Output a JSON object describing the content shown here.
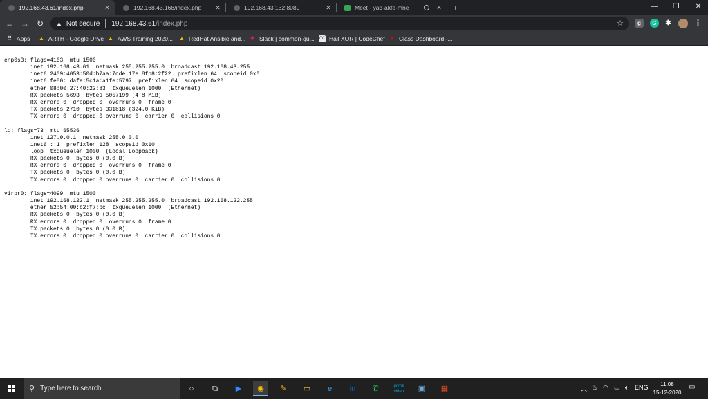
{
  "browser": {
    "tabs": [
      {
        "label": "192.168.43.61/index.php",
        "active": true,
        "icon": "globe-icon"
      },
      {
        "label": "192.168.43.168/index.php",
        "active": false,
        "icon": "globe-icon"
      },
      {
        "label": "192.168.43.132:8080",
        "active": false,
        "icon": "globe-icon"
      },
      {
        "label": "Meet - yab-akfe-mne",
        "active": false,
        "icon": "meet-icon"
      }
    ],
    "new_tab_symbol": "+",
    "window_controls": {
      "minimize": "—",
      "restore": "❐",
      "close": "✕"
    }
  },
  "toolbar": {
    "back": "←",
    "forward": "→",
    "reload": "↻",
    "security_label": "Not secure",
    "url_host": "192.168.43.61",
    "url_path": "/index.php"
  },
  "bookmarks": [
    {
      "label": "Apps",
      "icon": "apps-grid-icon"
    },
    {
      "label": "ARTH - Google Drive",
      "icon": "google-drive-icon"
    },
    {
      "label": "AWS Training 2020...",
      "icon": "google-drive-icon"
    },
    {
      "label": "RedHat Ansible and...",
      "icon": "google-drive-icon"
    },
    {
      "label": "Slack | common-qu...",
      "icon": "slack-icon"
    },
    {
      "label": "Hail XOR | CodeChef",
      "icon": "codechef-icon"
    },
    {
      "label": "Class Dashboard -...",
      "icon": "redhat-icon"
    }
  ],
  "extensions": [
    {
      "letter": "g",
      "color": "#5f6368"
    },
    {
      "letter": "G",
      "color": "#15c39a"
    },
    {
      "letter": "✱",
      "color": "#35363a"
    }
  ],
  "terminal": {
    "blocks": [
      [
        "enp0s3: flags=4163  mtu 1500",
        "        inet 192.168.43.61  netmask 255.255.255.0  broadcast 192.168.43.255",
        "        inet6 2409:4053:50d:b7aa:7dde:17e:8fb8:2f22  prefixlen 64  scopeid 0x0",
        "        inet6 fe80::dafe:5c1a:a1fe:5797  prefixlen 64  scopeid 0x20",
        "        ether 08:00:27:40:23:83  txqueuelen 1000  (Ethernet)",
        "        RX packets 5693  bytes 5057199 (4.8 MiB)",
        "        RX errors 0  dropped 0  overruns 0  frame 0",
        "        TX packets 2710  bytes 331818 (324.0 KiB)",
        "        TX errors 0  dropped 0 overruns 0  carrier 0  collisions 0"
      ],
      [
        "lo: flags=73  mtu 65536",
        "        inet 127.0.0.1  netmask 255.0.0.0",
        "        inet6 ::1  prefixlen 128  scopeid 0x10",
        "        loop  txqueuelen 1000  (Local Loopback)",
        "        RX packets 0  bytes 0 (0.0 B)",
        "        RX errors 0  dropped 0  overruns 0  frame 0",
        "        TX packets 0  bytes 0 (0.0 B)",
        "        TX errors 0  dropped 0 overruns 0  carrier 0  collisions 0"
      ],
      [
        "virbr0: flags=4099  mtu 1500",
        "        inet 192.168.122.1  netmask 255.255.255.0  broadcast 192.168.122.255",
        "        ether 52:54:00:b2:f7:bc  txqueuelen 1000  (Ethernet)",
        "        RX packets 0  bytes 0 (0.0 B)",
        "        RX errors 0  dropped 0  overruns 0  frame 0",
        "        TX packets 0  bytes 0 (0.0 B)",
        "        TX errors 0  dropped 0 overruns 0  carrier 0  collisions 0"
      ]
    ]
  },
  "taskbar": {
    "search_placeholder": "Type here to search",
    "apps": [
      {
        "name": "cortana-icon",
        "glyph": "○"
      },
      {
        "name": "task-view-icon",
        "glyph": "⧉"
      },
      {
        "name": "zoom-icon",
        "glyph": "▶"
      },
      {
        "name": "chrome-icon",
        "glyph": "◉",
        "active": true
      },
      {
        "name": "paint-icon",
        "glyph": "✎"
      },
      {
        "name": "file-explorer-icon",
        "glyph": "▭"
      },
      {
        "name": "edge-icon",
        "glyph": "e"
      },
      {
        "name": "linkedin-icon",
        "glyph": "in"
      },
      {
        "name": "whatsapp-icon",
        "glyph": "✆"
      },
      {
        "name": "prime-video-icon",
        "glyph": "prime video"
      },
      {
        "name": "virtualbox-icon",
        "glyph": "▣"
      },
      {
        "name": "media-app-icon",
        "glyph": "▦"
      }
    ],
    "language": "ENG",
    "time": "11:08",
    "date": "15-12-2020"
  },
  "colors": {
    "tabstrip_bg": "#202124",
    "toolbar_bg": "#35363a",
    "taskbar_bg": "#202020"
  }
}
